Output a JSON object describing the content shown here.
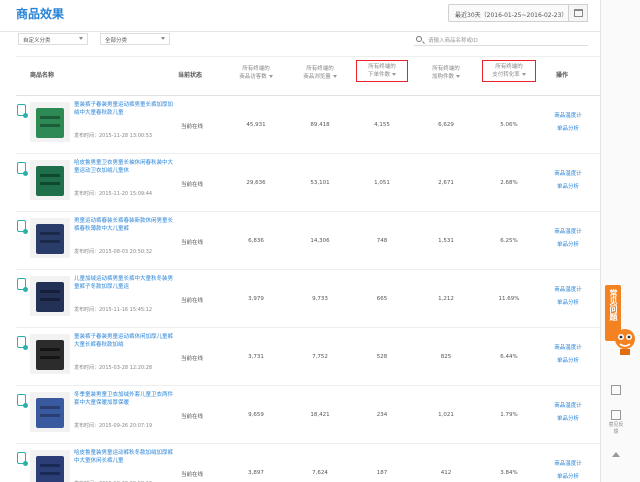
{
  "header": {
    "title": "商品效果",
    "date_range": "最近30天（2016-01-25~2016-02-23）"
  },
  "filters": {
    "select1": "自定义分类",
    "select2": "全部分类",
    "search_placeholder": "请输入商品名称或ID"
  },
  "columns": {
    "name": "商品名称",
    "status": "当前状态",
    "visitors_line1": "所有终端的",
    "visitors_line2": "商品访客数",
    "views_line1": "所有终端的",
    "views_line2": "商品浏览量",
    "orders_line1": "所有终端的",
    "orders_line2": "下单件数",
    "cart_line1": "所有终端的",
    "cart_line2": "加购件数",
    "conversion_line1": "所有终端的",
    "conversion_line2": "支付转化率",
    "actions": "操作"
  },
  "rows": [
    {
      "title": "童装裤子春装男童运动裤男童长裤加厚加绒中大童春秋款儿童",
      "time": "发布时间：2015-11-28 13:00:53",
      "status": "当前在线",
      "visitors": "45,931",
      "views": "89,418",
      "orders": "4,155",
      "cart": "6,629",
      "conversion": "5.06%",
      "action1": "商品温度计",
      "action2": "单品分析"
    },
    {
      "title": "哈皮鲁男童卫衣男童长袖休闲春秋装中大童运动卫衣加绒儿童休",
      "time": "发布时间：2015-11-20 15:09:44",
      "status": "当前在线",
      "visitors": "29,636",
      "views": "53,101",
      "orders": "1,051",
      "cart": "2,671",
      "conversion": "2.68%",
      "action1": "商品温度计",
      "action2": "单品分析"
    },
    {
      "title": "男童运动裤春装长裤春装新款休闲男童长裤春秋薄款中大儿童裤",
      "time": "发布时间：2015-08-03 20:50:32",
      "status": "当前在线",
      "visitors": "6,836",
      "views": "14,306",
      "orders": "748",
      "cart": "1,531",
      "conversion": "6.25%",
      "action1": "商品温度计",
      "action2": "单品分析"
    },
    {
      "title": "儿童加绒运动裤男童长裤中大童秋冬装男童裤子冬款加厚儿童运",
      "time": "发布时间：2015-11-16 15:45:12",
      "status": "当前在线",
      "visitors": "3,979",
      "views": "9,733",
      "orders": "665",
      "cart": "1,212",
      "conversion": "11.69%",
      "action1": "商品温度计",
      "action2": "单品分析"
    },
    {
      "title": "童装裤子春装男童运动裤休闲加厚儿童裤大童长裤春秋款加绒",
      "time": "发布时间：2015-03-28 12:20:28",
      "status": "当前在线",
      "visitors": "3,731",
      "views": "7,752",
      "orders": "528",
      "cart": "825",
      "conversion": "6.44%",
      "action1": "商品温度计",
      "action2": "单品分析"
    },
    {
      "title": "冬季童装男童卫衣加绒外套儿童卫衣两件套中大童保暖加厚保暖",
      "time": "发布时间：2015-09-26 20:07:19",
      "status": "当前在线",
      "visitors": "9,659",
      "views": "18,421",
      "orders": "234",
      "cart": "1,021",
      "conversion": "1.79%",
      "action1": "商品温度计",
      "action2": "单品分析"
    },
    {
      "title": "哈皮鲁童装男童运动裤秋冬款加绒加厚裤中大童休闲长裤儿童",
      "time": "发布时间：2015-10-28 20:58:16",
      "status": "当前在线",
      "visitors": "3,897",
      "views": "7,624",
      "orders": "187",
      "cart": "412",
      "conversion": "3.84%",
      "action1": "商品温度计",
      "action2": "单品分析"
    }
  ],
  "sidebar": {
    "faq_label": "常见问题",
    "qr_label": "",
    "feedback_label": "意见反馈",
    "top_label": "顶部"
  },
  "colors": {
    "accent": "#2a84d6",
    "highlight_box": "#e8232b",
    "faq": "#f58220",
    "device_icon": "#2cb1a8"
  }
}
